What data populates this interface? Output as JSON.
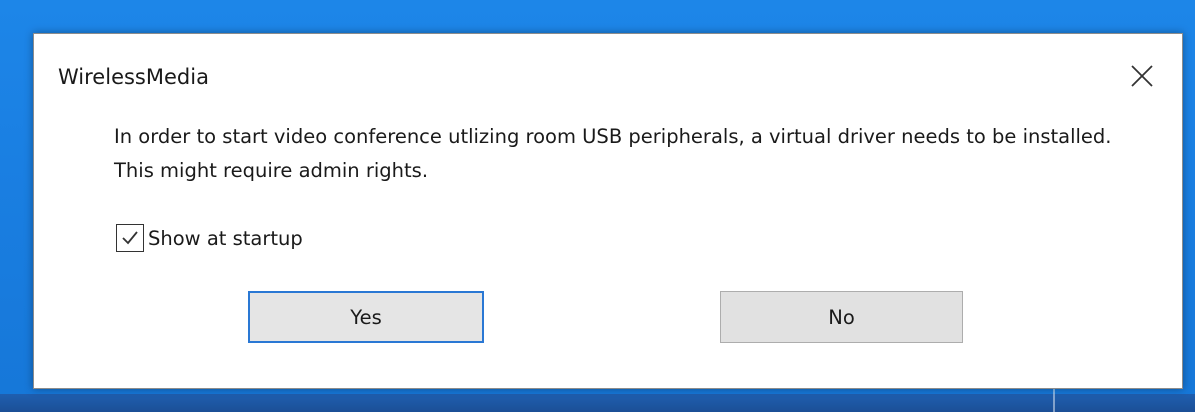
{
  "dialog": {
    "title": "WirelessMedia",
    "message": "In order to start video conference utlizing room USB peripherals, a virtual driver needs to be installed. This might require admin rights.",
    "checkbox": {
      "label": "Show at startup",
      "checked": true
    },
    "buttons": {
      "yes_label": "Yes",
      "no_label": "No"
    },
    "close_icon": "close-icon"
  },
  "colors": {
    "desktop": "#1a7fe2",
    "focus_border": "#2a78d4",
    "button_face": "#e1e1e1"
  }
}
